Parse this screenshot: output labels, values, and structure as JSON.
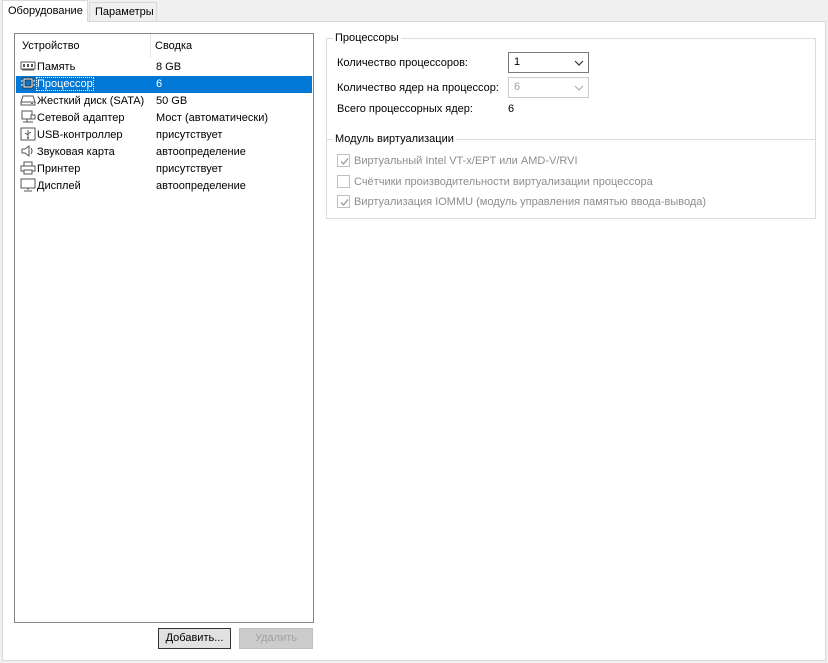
{
  "tabs": [
    {
      "label": "Оборудование",
      "active": true
    },
    {
      "label": "Параметры",
      "active": false
    }
  ],
  "device_list": {
    "columns": [
      "Устройство",
      "Сводка"
    ],
    "rows": [
      {
        "icon": "memory-icon",
        "device": "Память",
        "summary": "8 GB"
      },
      {
        "icon": "cpu-icon",
        "device": "Процессор",
        "summary": "6",
        "selected": true
      },
      {
        "icon": "hard-disk-icon",
        "device": "Жесткий диск (SATA)",
        "summary": "50 GB"
      },
      {
        "icon": "network-adapter-icon",
        "device": "Сетевой адаптер",
        "summary": "Мост (автоматически)"
      },
      {
        "icon": "usb-icon",
        "device": "USB-контроллер",
        "summary": "присутствует"
      },
      {
        "icon": "speaker-icon",
        "device": "Звуковая карта",
        "summary": "автоопределение"
      },
      {
        "icon": "printer-icon",
        "device": "Принтер",
        "summary": "присутствует"
      },
      {
        "icon": "monitor-icon",
        "device": "Дисплей",
        "summary": "автоопределение"
      }
    ]
  },
  "buttons": {
    "add": "Добавить...",
    "remove": "Удалить"
  },
  "processors": {
    "legend": "Процессоры",
    "num_processors_label": "Количество процессоров:",
    "num_processors_value": "1",
    "cores_per_processor_label": "Количество ядер на процессор:",
    "cores_per_processor_value": "6",
    "total_cores_label": "Всего процессорных ядер:",
    "total_cores_value": "6"
  },
  "virtualization": {
    "legend": "Модуль виртуализации",
    "options": [
      {
        "label": "Виртуальный Intel VT-x/EPT или AMD-V/RVI",
        "checked": true
      },
      {
        "label": "Счётчики производительности виртуализации процессора",
        "checked": false
      },
      {
        "label": "Виртуализация IOMMU (модуль управления памятью ввода-вывода)",
        "checked": true
      }
    ]
  }
}
